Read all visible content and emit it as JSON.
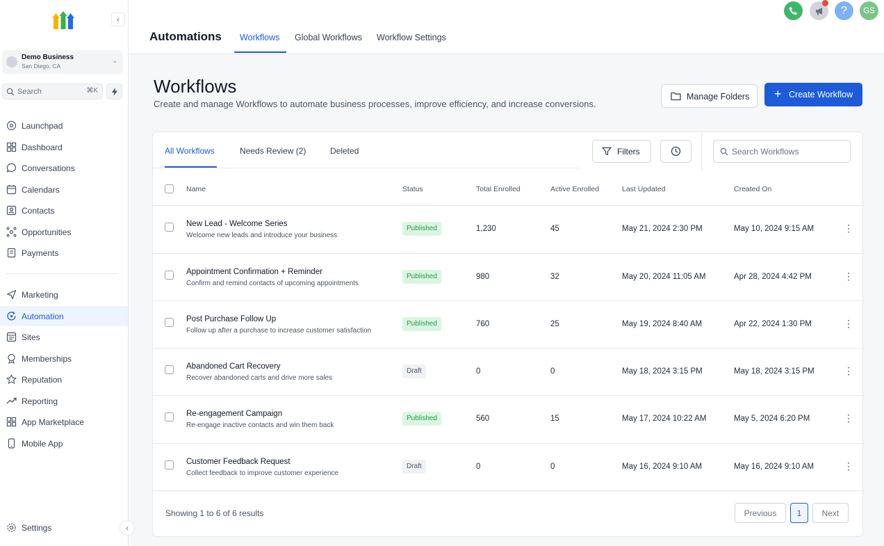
{
  "sidebar": {
    "account": {
      "name": "Demo Business",
      "location": "San Diego, CA"
    },
    "search": {
      "label": "Search",
      "shortcut": "⌘K"
    },
    "items": [
      {
        "label": "Launchpad",
        "icon": "launchpad-icon"
      },
      {
        "label": "Dashboard",
        "icon": "dashboard-icon"
      },
      {
        "label": "Conversations",
        "icon": "chat-icon"
      },
      {
        "label": "Calendars",
        "icon": "calendar-icon"
      },
      {
        "label": "Contacts",
        "icon": "contacts-icon"
      },
      {
        "label": "Opportunities",
        "icon": "opportunities-icon"
      },
      {
        "label": "Payments",
        "icon": "payments-icon"
      },
      {
        "label": "Marketing",
        "icon": "send-icon"
      },
      {
        "label": "Automation",
        "icon": "automation-icon",
        "active": true
      },
      {
        "label": "Sites",
        "icon": "sites-icon"
      },
      {
        "label": "Memberships",
        "icon": "memberships-icon"
      },
      {
        "label": "Reputation",
        "icon": "star-icon"
      },
      {
        "label": "Reporting",
        "icon": "trend-icon"
      },
      {
        "label": "App Marketplace",
        "icon": "grid-icon"
      },
      {
        "label": "Mobile App",
        "icon": "mobile-icon"
      }
    ],
    "settings_label": "Settings"
  },
  "topbar": {
    "title": "Automations",
    "tabs": [
      "Workflows",
      "Global Workflows",
      "Workflow Settings"
    ],
    "active_tab": "Workflows",
    "avatar_initials": "GS",
    "help_glyph": "?"
  },
  "header": {
    "title": "Workflows",
    "subtitle": "Create and manage Workflows to automate business processes, improve efficiency, and increase conversions.",
    "manage_folders_label": "Manage Folders",
    "create_label": "Create Workflow"
  },
  "list": {
    "tabs": [
      "All Workflows",
      "Needs Review (2)",
      "Deleted"
    ],
    "filters_label": "Filters",
    "search_placeholder": "Search Workflows",
    "columns": [
      "Name",
      "Status",
      "Total Enrolled",
      "Active Enrolled",
      "Last Updated",
      "Created On"
    ],
    "rows": [
      {
        "name": "New Lead - Welcome Series",
        "desc": "Welcome new leads and introduce your business",
        "status": "Published",
        "total": "1,230",
        "active": "45",
        "updated": "May 21, 2024 2:30 PM",
        "created": "May 10, 2024 9:15 AM"
      },
      {
        "name": "Appointment Confirmation + Reminder",
        "desc": "Confirm and remind contacts of upcoming appointments",
        "status": "Published",
        "total": "980",
        "active": "32",
        "updated": "May 20, 2024 11:05 AM",
        "created": "Apr 28, 2024 4:42 PM"
      },
      {
        "name": "Post Purchase Follow Up",
        "desc": "Follow up after a purchase to increase customer satisfaction",
        "status": "Published",
        "total": "760",
        "active": "25",
        "updated": "May 19, 2024 8:40 AM",
        "created": "Apr 22, 2024 1:30 PM"
      },
      {
        "name": "Abandoned Cart Recovery",
        "desc": "Recover abandoned carts and drive more sales",
        "status": "Draft",
        "total": "0",
        "active": "0",
        "updated": "May 18, 2024 3:15 PM",
        "created": "May 18, 2024 3:15 PM"
      },
      {
        "name": "Re-engagement Campaign",
        "desc": "Re-engage inactive contacts and win them back",
        "status": "Published",
        "total": "560",
        "active": "15",
        "updated": "May 17, 2024 10:22 AM",
        "created": "May 5, 2024 6:20 PM"
      },
      {
        "name": "Customer Feedback Request",
        "desc": "Collect feedback to improve customer experience",
        "status": "Draft",
        "total": "0",
        "active": "0",
        "updated": "May 16, 2024 9:10 AM",
        "created": "May 16, 2024 9:10 AM"
      }
    ],
    "footer": "Showing 1 to 6 of 6 results",
    "pagination": {
      "previous": "Previous",
      "current": "1",
      "next": "Next"
    }
  },
  "colors": {
    "accent": "#1d5bd8",
    "published_bg": "#dcf5e3",
    "published_text": "#1f9d45",
    "phone": "#3fb76a",
    "help": "#7fb1f5",
    "avatar": "#7cc48a"
  }
}
